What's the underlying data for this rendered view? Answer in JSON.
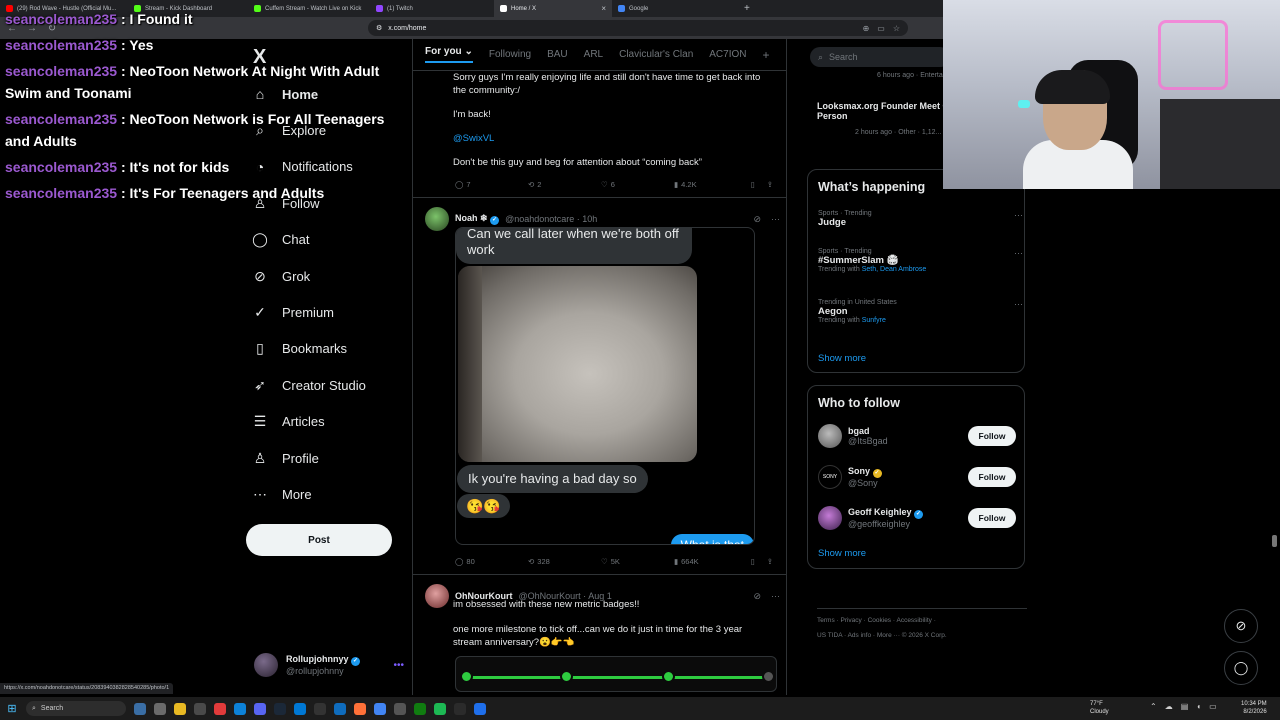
{
  "browser": {
    "tabs": [
      {
        "title": "(29) Rod Wave - Hustle (Official Mu...",
        "color": "#ff0000"
      },
      {
        "title": "Stream - Kick Dashboard",
        "color": "#53fc18"
      },
      {
        "title": "Cuffem Stream - Watch Live on Kick",
        "color": "#53fc18"
      },
      {
        "title": "(1) Twitch",
        "color": "#9146ff"
      },
      {
        "title": "Home / X",
        "color": "#ffffff",
        "active": true
      },
      {
        "title": "Google",
        "color": "#4285f4"
      }
    ],
    "url": "x.com/home",
    "status_url": "https://x.com/noahdonotcare/status/2083940382828540285/photo/1"
  },
  "chat_overlay": [
    {
      "user": "seancoleman235",
      "message": "I Found it"
    },
    {
      "user": "seancoleman235",
      "message": "Yes"
    },
    {
      "user": "seancoleman235",
      "message": "NeoToon Network At Night With Adult Swim and Toonami"
    },
    {
      "user": "seancoleman235",
      "message": "NeoToon Network is For All Teenagers and Adults"
    },
    {
      "user": "seancoleman235",
      "message": "It's not for kids"
    },
    {
      "user": "seancoleman235",
      "message": "It's For Teenagers and Adults"
    }
  ],
  "nav": {
    "logo": "X",
    "items": [
      {
        "label": "Home",
        "icon": "home-icon",
        "glyph": "⌂"
      },
      {
        "label": "Explore",
        "icon": "search-icon",
        "glyph": "⌕"
      },
      {
        "label": "Notifications",
        "icon": "bell-icon",
        "glyph": "🔔︎"
      },
      {
        "label": "Follow",
        "icon": "person-icon",
        "glyph": "👤︎"
      },
      {
        "label": "Chat",
        "icon": "chat-icon",
        "glyph": "◯"
      },
      {
        "label": "Grok",
        "icon": "grok-icon",
        "glyph": "⊘"
      },
      {
        "label": "Premium",
        "icon": "verified-icon",
        "glyph": "✓"
      },
      {
        "label": "Bookmarks",
        "icon": "bookmark-icon",
        "glyph": "⎕"
      },
      {
        "label": "Creator Studio",
        "icon": "rocket-icon",
        "glyph": "➶"
      },
      {
        "label": "Articles",
        "icon": "article-icon",
        "glyph": "☰"
      },
      {
        "label": "Profile",
        "icon": "profile-icon",
        "glyph": "👤︎"
      },
      {
        "label": "More",
        "icon": "more-circle-icon",
        "glyph": "⋯"
      }
    ],
    "post_label": "Post",
    "account": {
      "name": "Rollupjohnnyy",
      "handle": "@rollupjohnny"
    }
  },
  "feed": {
    "tabs": [
      "For you",
      "Following",
      "BAU",
      "ARL",
      "Clavicular's Clan",
      "AC7ION"
    ],
    "tweet1": {
      "lines": [
        "Sorry guys I'm really enjoying life and still don't have time to get back into the community:/",
        "I'm back!",
        "@SwixVL",
        "Don't be this guy and beg for attention about “coming back”"
      ],
      "replies": "7",
      "reposts": "2",
      "likes": "6",
      "views": "4.2K"
    },
    "tweet2": {
      "name": "Noah",
      "emoji": "❄",
      "handle": "@noahdonotcare",
      "time": "10h",
      "bubble1": "Can we call later when we're both off work",
      "bubble2": "Ik you're having a bad day so",
      "emojis": "😘😘",
      "sent": "What is that",
      "replies": "80",
      "reposts": "328",
      "likes": "5K",
      "views": "664K"
    },
    "tweet3": {
      "name": "OhNourKourt",
      "handle": "@OhNourKourt",
      "time": "Aug 1",
      "line1": "im obsessed with these new metric badges!!",
      "line2": "one more milestone to tick off...can we do it just in time for the 3 year stream anniversary?😮👉👈"
    }
  },
  "sidebar": {
    "search_placeholder": "Search",
    "top_item": {
      "meta1": "6 hours ago · Entertainm...",
      "title": "Looksmax.org Founder Meet Clavicular in Person",
      "meta2": "2 hours ago · Other · 1,12..."
    },
    "happening": {
      "title": "What’s happening",
      "trends": [
        {
          "meta": "Sports · Trending",
          "title": "Judge",
          "sub": ""
        },
        {
          "meta": "Sports · Trending",
          "title": "#SummerSlam 🏟",
          "sub_prefix": "Trending with",
          "sub": "Seth, Dean Ambrose"
        },
        {
          "meta": "Trending in United States",
          "title": "Aegon",
          "sub_prefix": "Trending with",
          "sub": "Sunfyre"
        }
      ],
      "show_more": "Show more"
    },
    "who_to_follow": {
      "title": "Who to follow",
      "accounts": [
        {
          "name": "bgad",
          "handle": "@ItsBgad",
          "btn": "Follow"
        },
        {
          "name": "Sony",
          "handle": "@Sony",
          "btn": "Follow"
        },
        {
          "name": "Geoff Keighley",
          "handle": "@geoffkeighley",
          "btn": "Follow"
        }
      ],
      "show_more": "Show more"
    },
    "footer": [
      "Terms",
      "Privacy",
      "Cookies",
      "Accessibility",
      "US TIDA",
      "Ads info",
      "More ···",
      "© 2026 X Corp."
    ]
  },
  "taskbar": {
    "search": "Search",
    "weather_temp": "77°F",
    "weather_desc": "Cloudy",
    "time": "10:34 PM",
    "date": "8/2/2026"
  }
}
